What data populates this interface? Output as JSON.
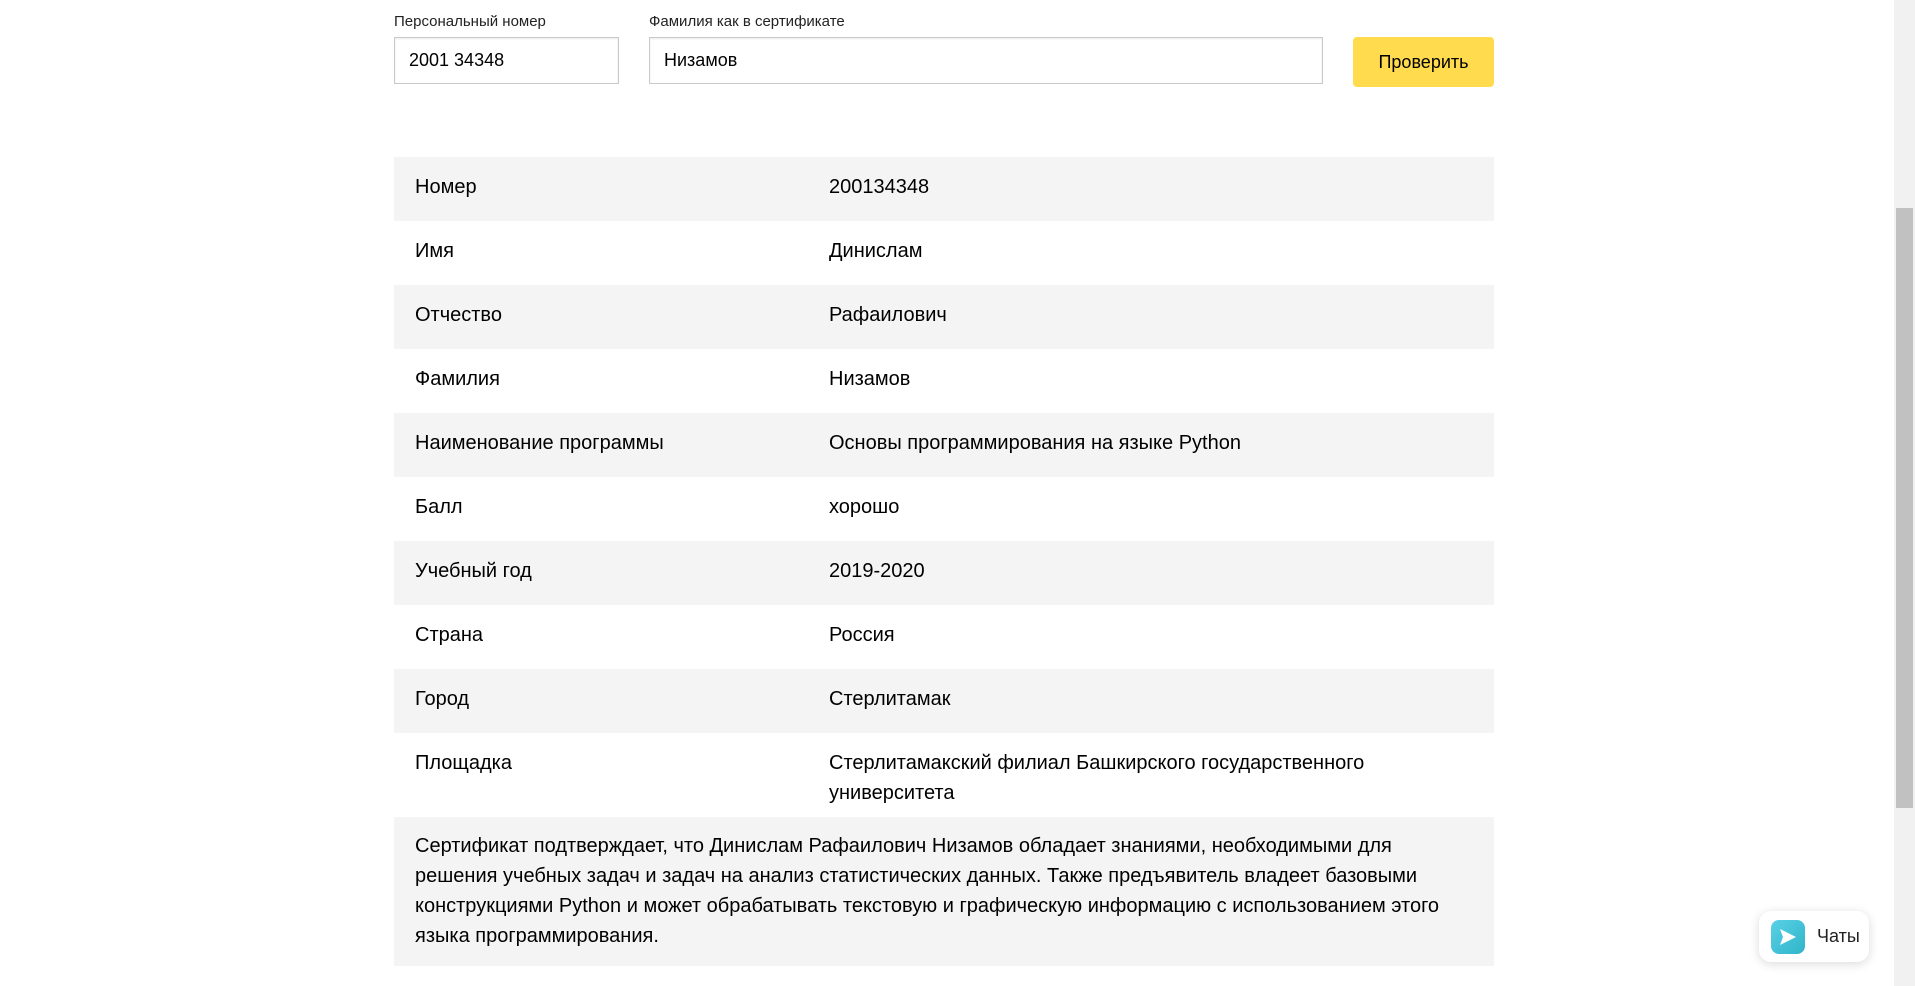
{
  "form": {
    "personal_number_label": "Персональный номер",
    "personal_number_value": "2001 34348",
    "surname_label": "Фамилия как в сертификате",
    "surname_value": "Низамов",
    "check_button_label": "Проверить"
  },
  "certificate": {
    "rows": [
      {
        "key": "Номер",
        "value": "200134348"
      },
      {
        "key": "Имя",
        "value": "Динислам"
      },
      {
        "key": "Отчество",
        "value": "Рафаилович"
      },
      {
        "key": "Фамилия",
        "value": "Низамов"
      },
      {
        "key": "Наименование программы",
        "value": "Основы программирования на языке Python"
      },
      {
        "key": "Балл",
        "value": "хорошо"
      },
      {
        "key": "Учебный год",
        "value": "2019-2020"
      },
      {
        "key": "Страна",
        "value": "Россия"
      },
      {
        "key": "Город",
        "value": "Стерлитамак"
      },
      {
        "key": "Площадка",
        "value": "Стерлитамакский филиал Башкирского государственного университета"
      }
    ],
    "statement": "Сертификат подтверждает, что Динислам Рафаилович Низамов обладает знаниями, необходимыми для решения учебных задач и задач на анализ статистических данных. Также предъявитель владеет базовыми конструкциями Python и может обрабатывать текстовую и графическую информацию с использованием этого языка программирования."
  },
  "chat_widget": {
    "label": "Чаты",
    "icon": "chat-send-icon"
  },
  "colors": {
    "accent_button": "#ffdb4d",
    "row_shade": "#f4f4f4"
  }
}
